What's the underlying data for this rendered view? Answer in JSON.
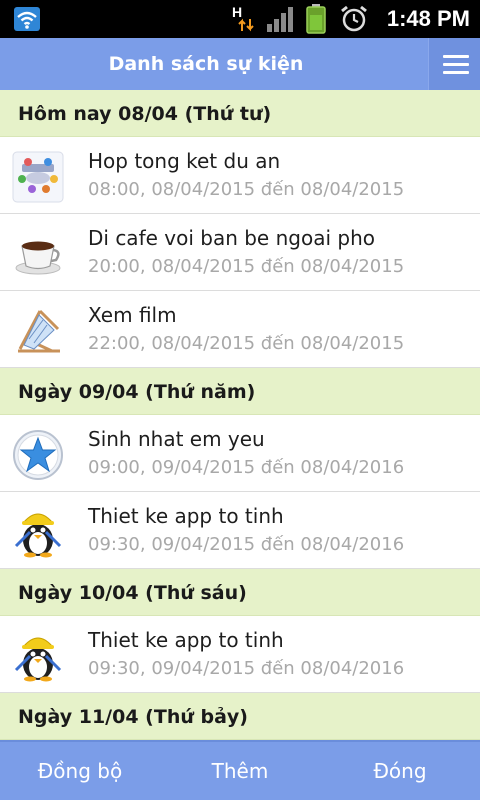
{
  "status_bar": {
    "time": "1:48 PM",
    "net_indicator": "H",
    "icons": [
      "wifi-icon",
      "data-transfer-icon",
      "signal-icon",
      "battery-icon",
      "alarm-icon"
    ]
  },
  "header": {
    "title": "Danh sách sự kiện",
    "menu_icon": "hamburger-menu-icon"
  },
  "sections": [
    {
      "title": "Hôm nay 08/04 (Thứ tư)",
      "events": [
        {
          "title": "Hop tong ket du an",
          "time": "08:00, 08/04/2015 đến 08/04/2015",
          "icon": "meeting-icon"
        },
        {
          "title": "Di cafe voi ban be ngoai pho",
          "time": "20:00, 08/04/2015 đến 08/04/2015",
          "icon": "coffee-cup-icon"
        },
        {
          "title": "Xem film",
          "time": "22:00, 08/04/2015 đến 08/04/2015",
          "icon": "beach-chair-icon"
        }
      ]
    },
    {
      "title": "Ngày 09/04 (Thứ năm)",
      "events": [
        {
          "title": "Sinh nhat em yeu",
          "time": "09:00, 09/04/2015 đến 08/04/2016",
          "icon": "star-icon"
        },
        {
          "title": "Thiet ke app to tinh",
          "time": "09:30, 09/04/2015 đến 08/04/2016",
          "icon": "penguin-worker-icon"
        }
      ]
    },
    {
      "title": "Ngày 10/04 (Thứ sáu)",
      "events": [
        {
          "title": "Thiet ke app to tinh",
          "time": "09:30, 09/04/2015 đến 08/04/2016",
          "icon": "penguin-worker-icon"
        }
      ]
    },
    {
      "title": "Ngày 11/04 (Thứ bảy)",
      "events": []
    }
  ],
  "bottom_bar": {
    "sync_label": "Đồng bộ",
    "add_label": "Thêm",
    "close_label": "Đóng"
  },
  "colors": {
    "header_bg": "#7b9de8",
    "section_bg": "#e6f2c9",
    "time_text": "#a8a8a8"
  }
}
